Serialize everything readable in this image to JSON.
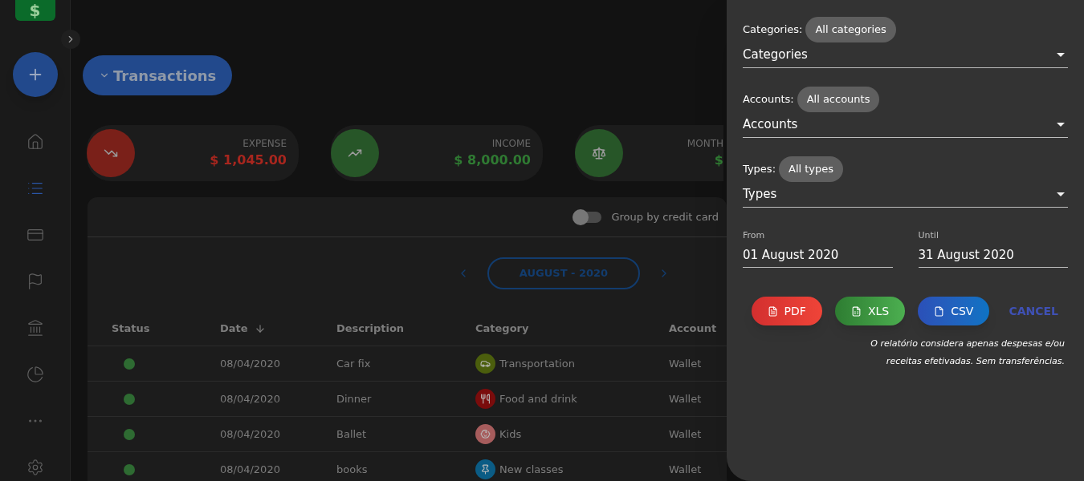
{
  "sidebar": {
    "logo_text": "$",
    "items": [
      {
        "kind": "home",
        "selected": false
      },
      {
        "kind": "list",
        "selected": true
      },
      {
        "kind": "wallet",
        "selected": false
      },
      {
        "kind": "flag",
        "selected": false
      },
      {
        "kind": "bank",
        "selected": false
      },
      {
        "kind": "pie",
        "selected": false
      },
      {
        "kind": "more",
        "selected": false
      },
      {
        "kind": "settings",
        "selected": false
      }
    ]
  },
  "page_title": "Transactions",
  "summary": [
    {
      "kind": "expense",
      "label": "EXPENSE",
      "value": "$ 1,045.00"
    },
    {
      "kind": "income",
      "label": "INCOME",
      "value": "$ 8,000.00"
    },
    {
      "kind": "balance",
      "label": "MONTH",
      "value": "$"
    }
  ],
  "group_toggle": {
    "label": "Group by credit card",
    "on": false
  },
  "period": "AUGUST - 2020",
  "table": {
    "columns": [
      "Status",
      "Date",
      "Description",
      "Category",
      "Account"
    ],
    "rows": [
      {
        "paid": true,
        "date": "08/04/2020",
        "description": "Car fix",
        "category": {
          "name": "Transportation",
          "kind": "car",
          "color": "#4b5e0d"
        },
        "account": "Wallet"
      },
      {
        "paid": true,
        "date": "08/04/2020",
        "description": "Dinner",
        "category": {
          "name": "Food and drink",
          "kind": "food",
          "color": "#7a0c0c"
        },
        "account": "Wallet"
      },
      {
        "paid": true,
        "date": "08/04/2020",
        "description": "Ballet",
        "category": {
          "name": "Kids",
          "kind": "kids",
          "color": "#a65c5c"
        },
        "account": "Wallet"
      },
      {
        "paid": true,
        "date": "08/04/2020",
        "description": "books",
        "category": {
          "name": "New classes",
          "kind": "pin",
          "color": "#0b5c85"
        },
        "account": "Wallet"
      }
    ]
  },
  "report_panel": {
    "filters": [
      {
        "label": "Categories:",
        "chip": "All categories",
        "select": "Categories"
      },
      {
        "label": "Accounts:",
        "chip": "All accounts",
        "select": "Accounts"
      },
      {
        "label": "Types:",
        "chip": "All types",
        "select": "Types"
      }
    ],
    "dates": [
      {
        "label": "From",
        "value": "01 August 2020"
      },
      {
        "label": "Until",
        "value": "31 August 2020"
      }
    ],
    "buttons": [
      {
        "kind": "pdf",
        "label": "PDF"
      },
      {
        "kind": "xls",
        "label": "XLS"
      },
      {
        "kind": "csv",
        "label": "CSV"
      },
      {
        "kind": "cancel",
        "label": "CANCEL"
      }
    ],
    "note": "O relatório considera apenas despesas e/ou receitas efetivadas. Sem transferências."
  }
}
